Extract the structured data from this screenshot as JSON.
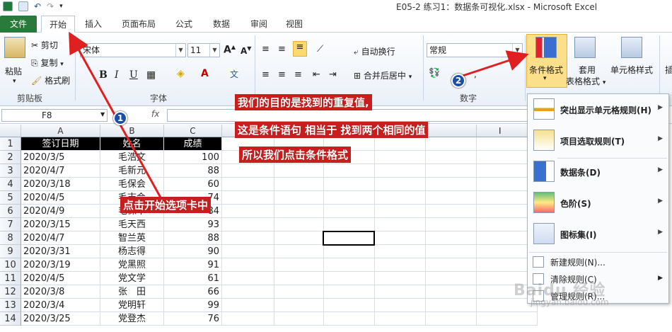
{
  "titlebar": {
    "title": "E05-2 练习1：数据条可视化.xlsx - Microsoft Excel"
  },
  "tabs": {
    "file": "文件",
    "home": "开始",
    "insert": "插入",
    "page_layout": "页面布局",
    "formulas": "公式",
    "data": "数据",
    "review": "审阅",
    "view": "视图"
  },
  "ribbon": {
    "paste": "粘贴",
    "cut": "剪切",
    "copy": "复制",
    "format_painter": "格式刷",
    "clipboard_group": "剪贴板",
    "font_name": "宋体",
    "font_size": "11",
    "font_group": "字体",
    "bold": "B",
    "italic": "I",
    "underline": "U",
    "wrap_text": "自动换行",
    "merge_center": "合并后居中",
    "number_format": "常规",
    "number_group": "数字",
    "conditional_formatting": "条件格式",
    "format_as_table_1": "套用",
    "format_as_table_2": "表格格式",
    "cell_styles": "单元格样式",
    "insert_cut": "插"
  },
  "formula_bar": {
    "name_box": "F8",
    "fx": "fx",
    "content": ""
  },
  "columns": [
    "A",
    "B",
    "C"
  ],
  "row_numbers": [
    "1",
    "2",
    "3",
    "4",
    "5",
    "6",
    "7",
    "8",
    "9",
    "10",
    "11",
    "12",
    "13",
    "14"
  ],
  "table": {
    "headers": [
      "签订日期",
      "姓名",
      "成绩"
    ],
    "rows": [
      [
        "2020/3/5",
        "毛浩文",
        "100"
      ],
      [
        "2020/4/7",
        "毛新元",
        "88"
      ],
      [
        "2020/3/18",
        "毛保会",
        "60"
      ],
      [
        "2020/4/5",
        "毛志会",
        "74"
      ],
      [
        "2020/4/9",
        "毛保华",
        "84"
      ],
      [
        "2020/3/15",
        "毛天西",
        "93"
      ],
      [
        "2020/4/7",
        "智兰英",
        "88"
      ],
      [
        "2020/3/31",
        "杨志得",
        "90"
      ],
      [
        "2020/3/19",
        "党黑照",
        "91"
      ],
      [
        "2020/4/5",
        "党文学",
        "61"
      ],
      [
        "2020/3/8",
        "张　田",
        "66"
      ],
      [
        "2020/3/4",
        "党明轩",
        "99"
      ],
      [
        "2020/3/25",
        "党登杰",
        "76"
      ]
    ]
  },
  "menu": {
    "highlight_rules": "突出显示单元格规则(H)",
    "top_bottom_rules": "项目选取规则(T)",
    "data_bars": "数据条(D)",
    "color_scales": "色阶(S)",
    "icon_sets": "图标集(I)",
    "new_rule": "新建规则(N)...",
    "clear_rules": "清除规则(C)",
    "manage_rules": "管理规则(R)..."
  },
  "annotations": {
    "badge1": "1",
    "badge2": "2",
    "note1": "点击开始选项卡中",
    "note2": "我们的目的是找到的重复值,",
    "note3": "这是条件语句 相当于 找到两个相同的值",
    "note4": "所以我们点击条件格式"
  },
  "watermark": {
    "text": "Baidu 经验",
    "url": "jingyan.baidu.com"
  },
  "colors": {
    "file_tab": "#2a7a3b",
    "annotation_red": "#c81e1e",
    "badge_blue": "#1b4ea8"
  }
}
